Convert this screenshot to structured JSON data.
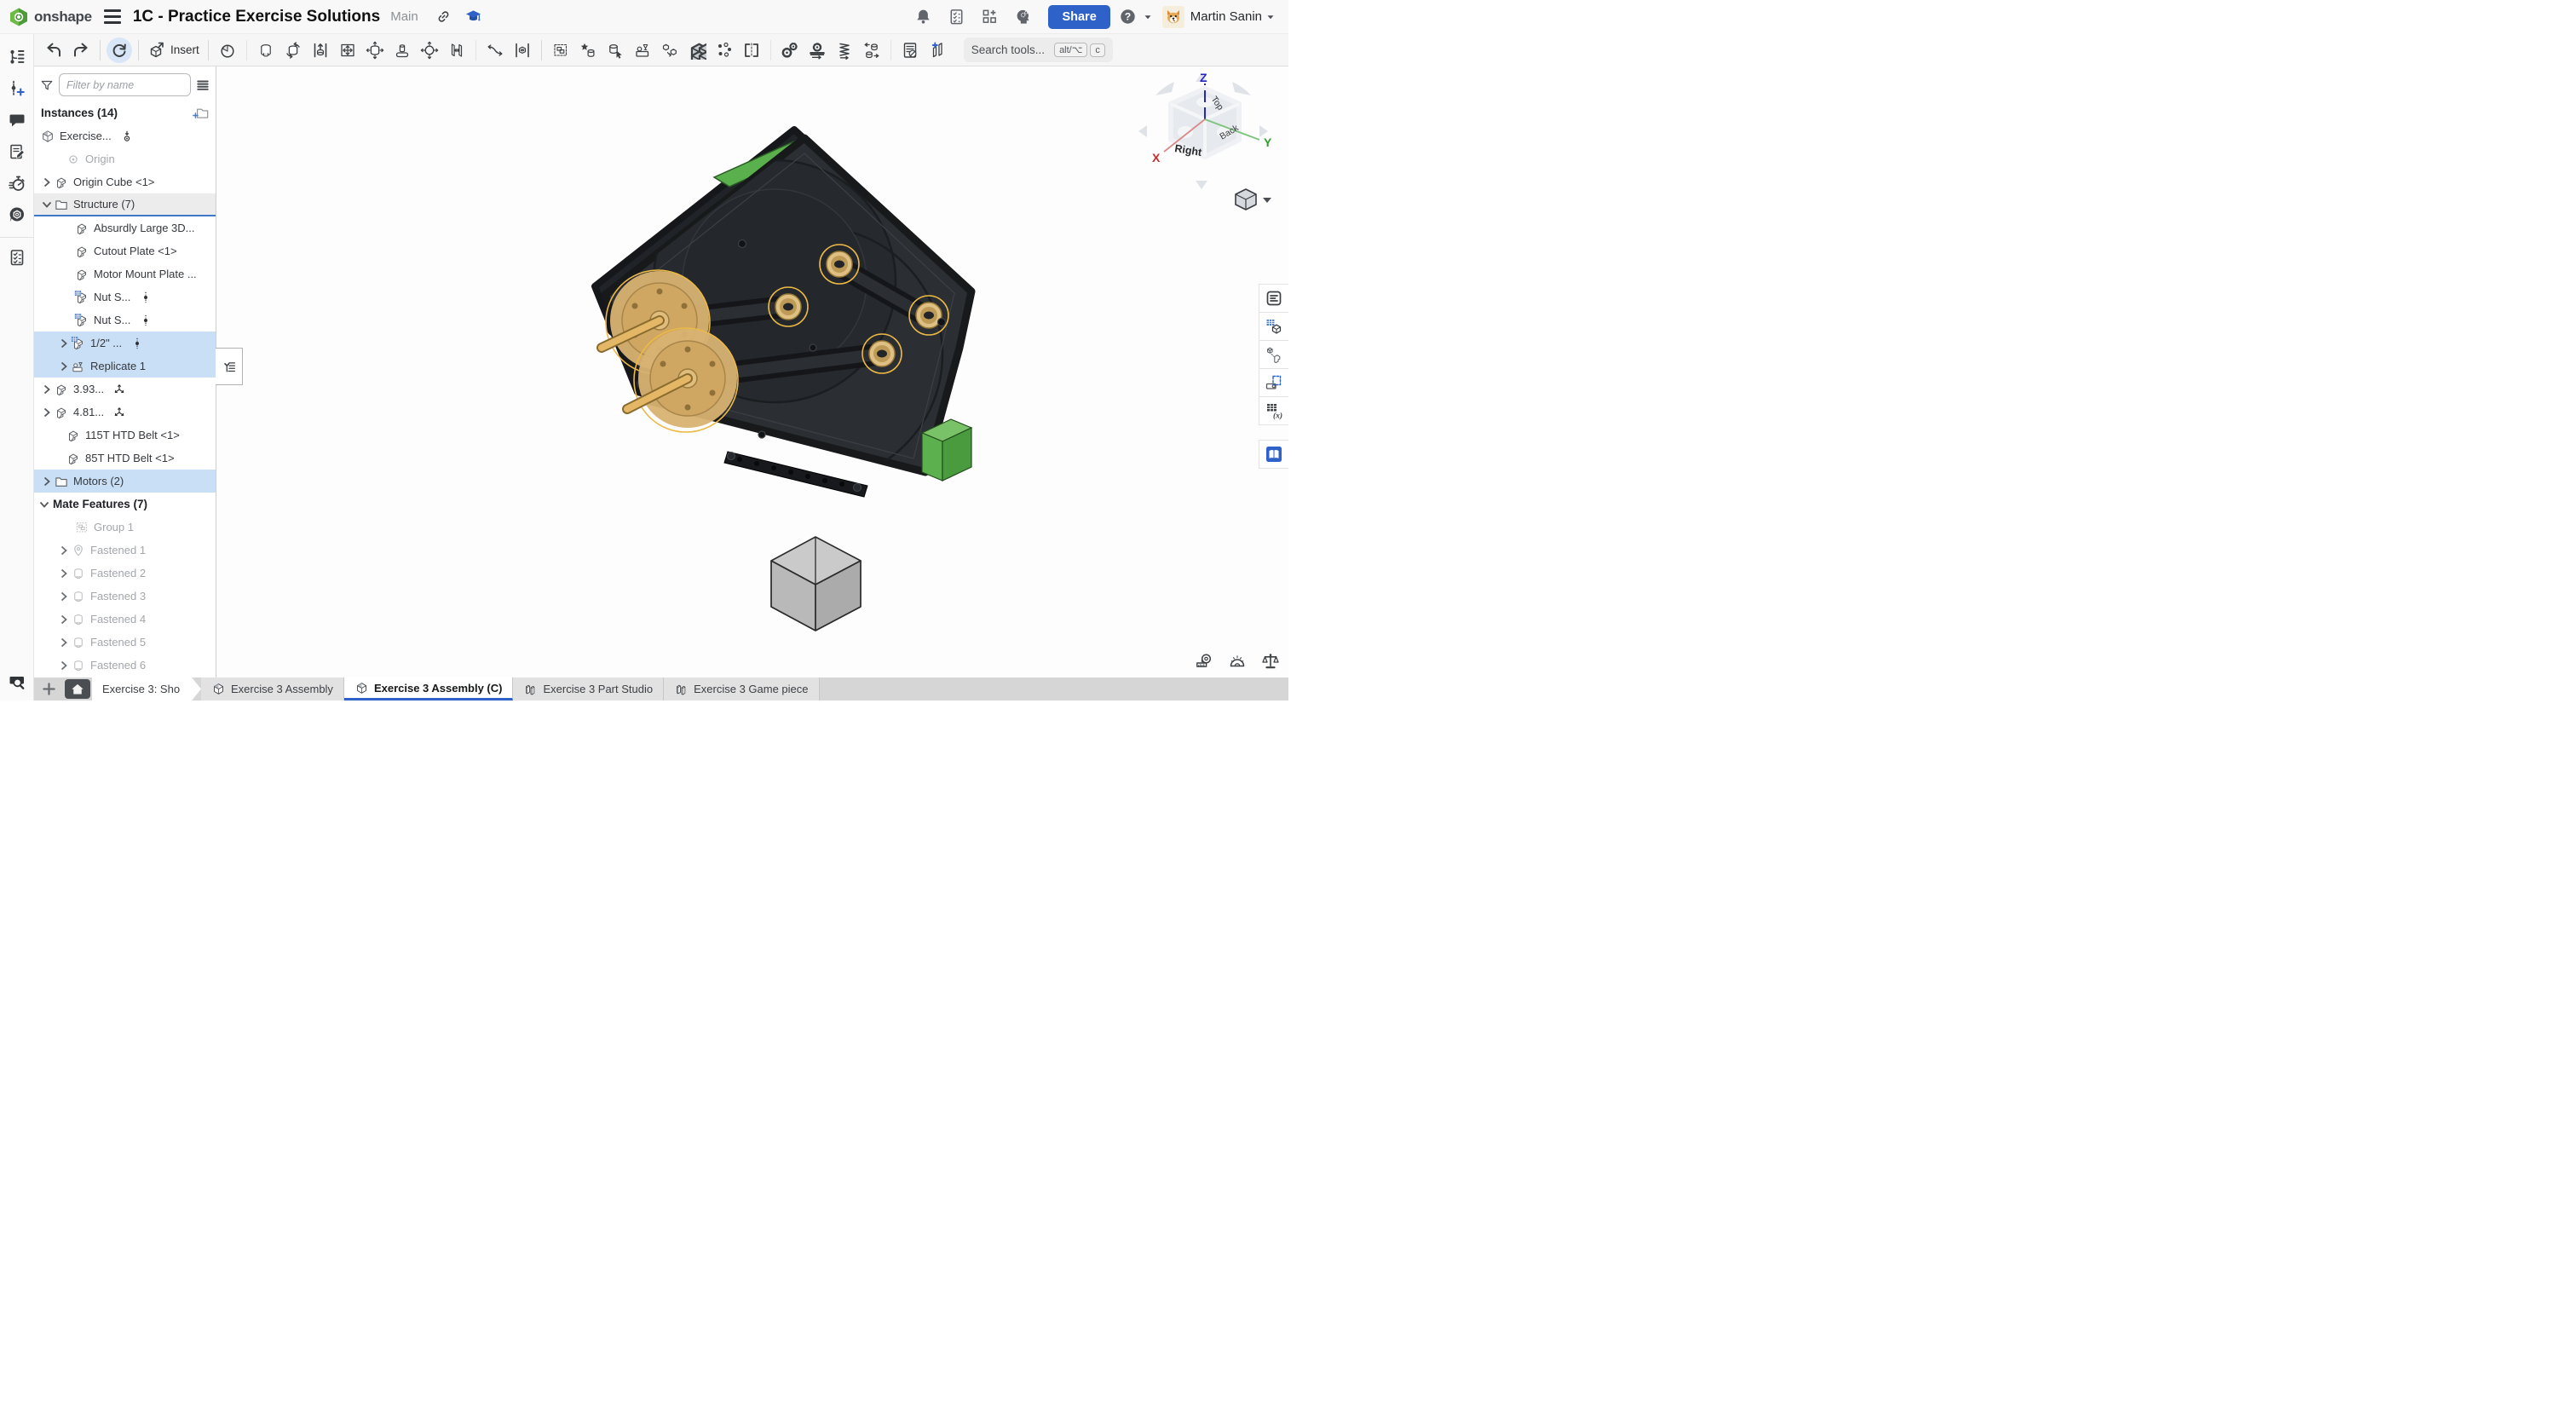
{
  "header": {
    "logo_text": "onshape",
    "document_title": "1C - Practice Exercise Solutions",
    "workspace": "Main",
    "share_label": "Share",
    "user_name": "Martin Sanin",
    "right_icon_names": [
      "notifications-bell",
      "task-list",
      "apps-grid-plus",
      "ai-assistant-head",
      "help-circle",
      "user-avatar"
    ]
  },
  "toolbar": {
    "insert_label": "Insert",
    "search_placeholder": "Search tools...",
    "search_keys": [
      "alt/⌥",
      "c"
    ],
    "icon_names": [
      "undo",
      "redo",
      "update-linked-documents",
      "insert",
      "mate",
      "fastened-mate",
      "revolute-mate",
      "slider-mate",
      "planar-mate",
      "cylindrical-mate",
      "pin-slot-mate",
      "ball-mate",
      "parallel-mate",
      "tangent-mate",
      "mate-connector",
      "group",
      "named-positions",
      "move-part",
      "snapshot",
      "replicate",
      "linear-pattern",
      "circular-pattern",
      "mirror",
      "gear-relation",
      "rack-and-pinion-relation",
      "screw-relation",
      "belt-relation",
      "bom-visibility",
      "exploded-view"
    ]
  },
  "left_dock": {
    "icon_names": [
      "version-graph",
      "create-version",
      "comments",
      "document-notes",
      "history",
      "onshape-assistant",
      "task-checklist",
      "tab-search"
    ]
  },
  "right_dock": {
    "icon_names": [
      "feature-list-panel",
      "configurations-panel",
      "in-context-panel",
      "appearance-panel",
      "variables-panel",
      "learning-panel"
    ]
  },
  "instances_panel": {
    "filter_placeholder": "Filter by name",
    "instances_header": "Instances (14)",
    "mate_features_header": "Mate Features (7)",
    "tree": [
      {
        "label": "Exercise..."
      },
      {
        "label": "Origin"
      },
      {
        "label": "Origin Cube <1>"
      },
      {
        "label": "Structure (7)"
      },
      {
        "label": "Absurdly Large 3D..."
      },
      {
        "label": "Cutout Plate <1>"
      },
      {
        "label": "Motor Mount Plate ..."
      },
      {
        "label": "Nut S..."
      },
      {
        "label": "Nut S..."
      },
      {
        "label": "1/2\" ..."
      },
      {
        "label": "Replicate 1"
      },
      {
        "label": "3.93..."
      },
      {
        "label": "4.81..."
      },
      {
        "label": "115T HTD Belt <1>"
      },
      {
        "label": "85T HTD Belt <1>"
      },
      {
        "label": "Motors (2)"
      },
      {
        "label": "Group 1"
      },
      {
        "label": "Fastened 1"
      },
      {
        "label": "Fastened 2"
      },
      {
        "label": "Fastened 3"
      },
      {
        "label": "Fastened 4"
      },
      {
        "label": "Fastened 5"
      },
      {
        "label": "Fastened 6"
      }
    ]
  },
  "viewport": {
    "view_cube": {
      "axis_x": "X",
      "axis_y": "Y",
      "axis_z": "Z",
      "face_top": "Top",
      "face_right": "Right",
      "face_back": "Back",
      "axis_colors": {
        "x": "#cc2a2a",
        "y": "#2f9e2f",
        "z": "#2525c4"
      }
    },
    "bottom_tools": [
      "measure-tape",
      "protractor",
      "mass-properties"
    ],
    "model_colors": {
      "plate": "#2b2e32",
      "accent_green": "#5ab04c",
      "selection_gold": "#ecb945",
      "motor_tan": "#d8b272"
    }
  },
  "tabs": {
    "items": [
      {
        "label": "Exercise 3: Sho"
      },
      {
        "label": "Exercise 3 Assembly"
      },
      {
        "label": "Exercise 3 Assembly (C)"
      },
      {
        "label": "Exercise 3 Part Studio"
      },
      {
        "label": "Exercise 3 Game piece"
      }
    ]
  }
}
